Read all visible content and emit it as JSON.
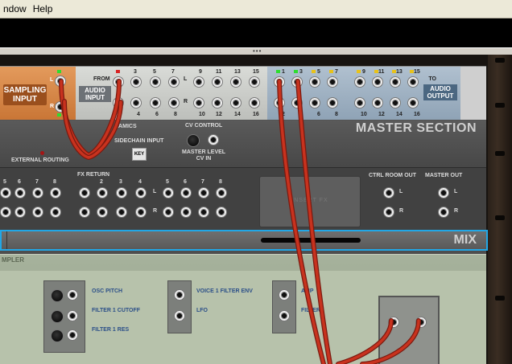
{
  "menubar": {
    "items": [
      "ndow",
      "Help"
    ]
  },
  "rack": {
    "sampling_input": {
      "line1": "SAMPLING",
      "line2": "INPUT",
      "side_l": "L",
      "side_r": "R"
    },
    "audio_input": {
      "from": "FROM",
      "line1": "AUDIO",
      "line2": "INPUT",
      "numbers_top": [
        "3",
        "5",
        "7",
        "9",
        "11",
        "13",
        "15"
      ],
      "numbers_bottom": [
        "2",
        "4",
        "6",
        "8",
        "10",
        "12",
        "14",
        "16"
      ],
      "side_l": "L",
      "side_r": "R"
    },
    "audio_output": {
      "to": "TO",
      "line1": "AUDIO",
      "line2": "OUTPUT",
      "numbers_top": [
        "1",
        "3",
        "5",
        "7",
        "9",
        "11",
        "13",
        "15"
      ],
      "numbers_bottom": [
        "2",
        "4",
        "6",
        "8",
        "10",
        "12",
        "14",
        "16"
      ]
    },
    "master_section": {
      "title": "MASTER SECTION",
      "dynamics": "NAMICS",
      "sidechain_input": "SIDECHAIN INPUT",
      "key_button": "KEY",
      "cv_control": "CV CONTROL",
      "master_level_cv_in": "MASTER LEVEL\nCV IN",
      "external_routing": "EXTERNAL ROUTING",
      "fx_return": "FX RETURN",
      "fx_return_numbers": [
        "2",
        "3",
        "4"
      ],
      "left_numbers": [
        "5",
        "6",
        "7",
        "8"
      ],
      "right_numbers": [
        "5",
        "6",
        "7",
        "8"
      ],
      "ctrl_room_out": "CTRL ROOM OUT",
      "master_out": "MASTER OUT",
      "insert_fx": "INSERT FX",
      "side_l": "L",
      "side_r": "R"
    },
    "mix": {
      "title": "MIX"
    },
    "sampler": {
      "logo": "MPLER",
      "osc_pitch": "OSC PITCH",
      "filter1_cutoff": "FILTER 1 CUTOFF",
      "filter1_res": "FILTER 1 RES",
      "voice1_filter_env": "VOICE 1 FILTER ENV",
      "lfo": "LFO",
      "amp": "AMP",
      "filter": "FILTER"
    }
  },
  "colors": {
    "accent_mix_border": "#21a7e6",
    "cable_red": "#c8321e",
    "led_green": "#2fdc2f",
    "led_yellow": "#e8c21a"
  }
}
